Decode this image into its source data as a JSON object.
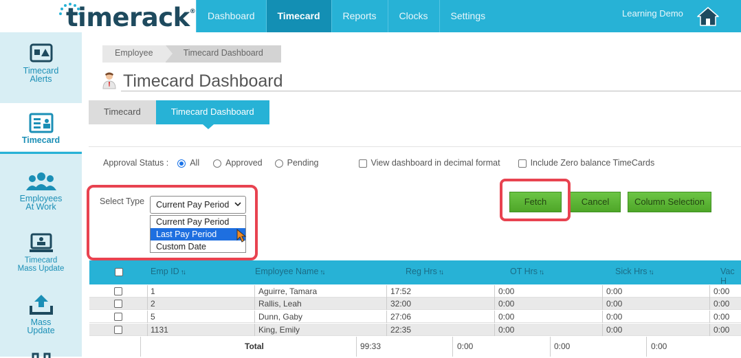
{
  "brand": {
    "logo": "timerack",
    "reg": "®"
  },
  "nav": [
    "Dashboard",
    "Timecard",
    "Reports",
    "Clocks",
    "Settings"
  ],
  "user": {
    "name": "Learning Demo"
  },
  "sidebar": [
    {
      "label1": "Timecard",
      "label2": "Alerts"
    },
    {
      "label1": "Timecard",
      "label2": ""
    },
    {
      "label1": "Employees",
      "label2": "At Work"
    },
    {
      "label1": "Timecard",
      "label2": "Mass Update"
    },
    {
      "label1": "Mass",
      "label2": "Update"
    }
  ],
  "breadcrumb": [
    "Employee",
    "Timecard Dashboard"
  ],
  "page_title": "Timecard Dashboard",
  "tabs": [
    "Timecard",
    "Timecard Dashboard"
  ],
  "filters": {
    "approval_label": "Approval Status :",
    "options": [
      "All",
      "Approved",
      "Pending"
    ],
    "selected": "All",
    "decimal_label": "View dashboard in decimal format",
    "zero_label": "Include Zero balance TimeCards"
  },
  "select_type": {
    "label": "Select Type",
    "value": "Current Pay Period",
    "options": [
      "Current Pay Period",
      "Last Pay Period",
      "Custom Date"
    ],
    "highlighted": "Last Pay Period"
  },
  "buttons": {
    "fetch": "Fetch",
    "cancel": "Cancel",
    "columns": "Column Selection"
  },
  "table": {
    "headers": [
      "Emp ID",
      "Employee Name",
      "Reg Hrs",
      "OT Hrs",
      "Sick Hrs",
      "Vac H"
    ],
    "rows": [
      {
        "id": "1",
        "name": "Aguirre, Tamara",
        "reg": "17:52",
        "ot": "0:00",
        "sick": "0:00",
        "vac": "0:00"
      },
      {
        "id": "2",
        "name": "Rallis, Leah",
        "reg": "32:00",
        "ot": "0:00",
        "sick": "0:00",
        "vac": "0:00"
      },
      {
        "id": "5",
        "name": "Dunn, Gaby",
        "reg": "27:06",
        "ot": "0:00",
        "sick": "0:00",
        "vac": "0:00"
      },
      {
        "id": "1131",
        "name": "King, Emily",
        "reg": "22:35",
        "ot": "0:00",
        "sick": "0:00",
        "vac": "0:00"
      }
    ],
    "total": {
      "label": "Total",
      "reg": "99:33",
      "ot": "0:00",
      "sick": "0:00",
      "vac": "0:00"
    }
  },
  "colors": {
    "accent": "#27b2d6",
    "highlight": "#e84350",
    "button": "#57b52f"
  }
}
